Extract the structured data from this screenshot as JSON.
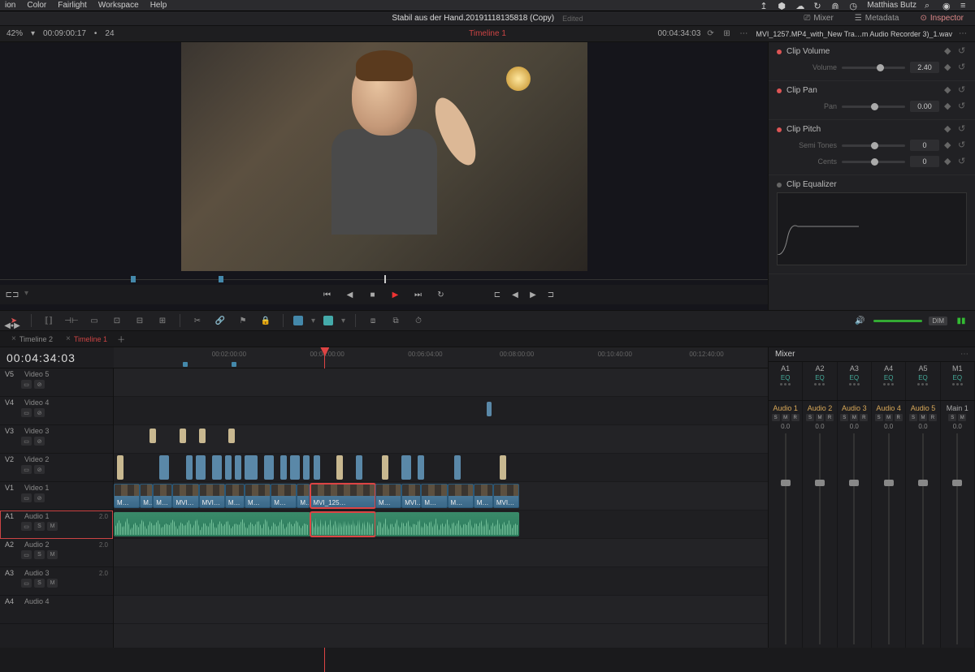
{
  "menubar": {
    "items": [
      "ion",
      "Color",
      "Fairlight",
      "Workspace",
      "Help"
    ],
    "user": "Matthias Butz"
  },
  "project": {
    "title": "Stabil aus der Hand.20191118135818 (Copy)",
    "edited": "Edited"
  },
  "header_tabs": {
    "mixer": "Mixer",
    "metadata": "Metadata",
    "inspector": "Inspector"
  },
  "status": {
    "zoom": "42%",
    "tc_left": "00:09:00:17",
    "fps": "24",
    "timeline_name": "Timeline 1",
    "tc_right": "00:04:34:03",
    "clip_file": "MVI_1257.MP4_with_New Tra…m Audio Recorder 3)_1.wav"
  },
  "inspector": {
    "clip_volume": {
      "title": "Clip Volume",
      "volume_label": "Volume",
      "volume_val": "2.40"
    },
    "clip_pan": {
      "title": "Clip Pan",
      "pan_label": "Pan",
      "pan_val": "0.00"
    },
    "clip_pitch": {
      "title": "Clip Pitch",
      "semi_label": "Semi Tones",
      "semi_val": "0",
      "cents_label": "Cents",
      "cents_val": "0"
    },
    "clip_eq": {
      "title": "Clip Equalizer"
    }
  },
  "volume_box": "DIM",
  "tabs": [
    {
      "label": "Timeline 2"
    },
    {
      "label": "Timeline 1"
    }
  ],
  "timeline_tc": "00:04:34:03",
  "ruler_ticks": [
    "00:02:00:00",
    "00:04:00:00",
    "00:06:04:00",
    "00:08:00:00",
    "00:10:40:00",
    "00:12:40:00"
  ],
  "tracks": {
    "video": [
      {
        "id": "V5",
        "name": "Video 5"
      },
      {
        "id": "V4",
        "name": "Video 4"
      },
      {
        "id": "V3",
        "name": "Video 3"
      },
      {
        "id": "V2",
        "name": "Video 2"
      },
      {
        "id": "V1",
        "name": "Video 1"
      }
    ],
    "audio": [
      {
        "id": "A1",
        "name": "Audio 1",
        "val": "2.0"
      },
      {
        "id": "A2",
        "name": "Audio 2",
        "val": "2.0"
      },
      {
        "id": "A3",
        "name": "Audio 3",
        "val": "2.0"
      },
      {
        "id": "A4",
        "name": "Audio 4"
      }
    ]
  },
  "clip_labels": {
    "m": "M…",
    "mvi": "MVI…",
    "mvi125": "MVI_125…"
  },
  "mixer": {
    "title": "Mixer",
    "buses": [
      "A1",
      "A2",
      "A3",
      "A4",
      "A5",
      "M1"
    ],
    "eq": "EQ",
    "channels": [
      {
        "name": "Audio 1",
        "db": "0.0"
      },
      {
        "name": "Audio 2",
        "db": "0.0"
      },
      {
        "name": "Audio 3",
        "db": "0.0"
      },
      {
        "name": "Audio 4",
        "db": "0.0"
      },
      {
        "name": "Audio 5",
        "db": "0.0"
      },
      {
        "name": "Main 1",
        "db": "0.0"
      }
    ]
  }
}
